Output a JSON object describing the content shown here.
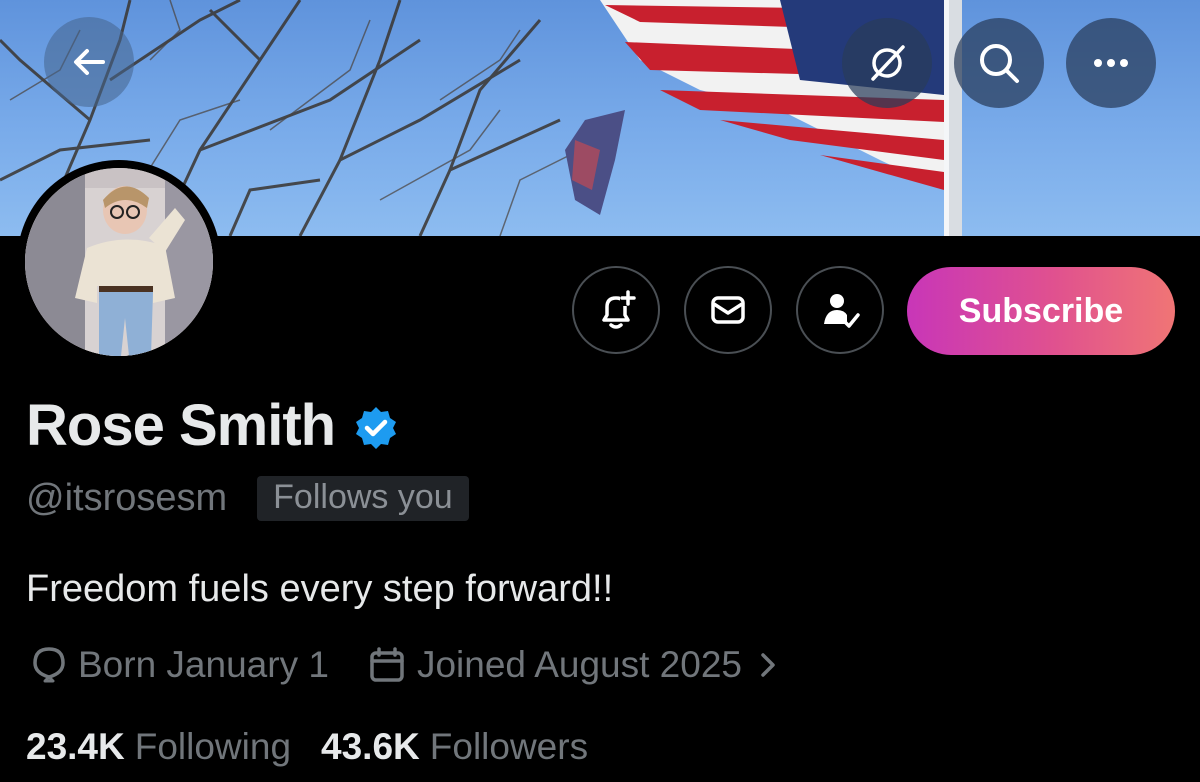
{
  "header": {
    "back_icon": "arrow-left-icon",
    "grok_icon": "grok-icon",
    "search_icon": "search-icon",
    "more_icon": "more-horizontal-icon"
  },
  "profile": {
    "name": "Rose Smith",
    "verified": true,
    "handle": "@itsrosesm",
    "follows_you": "Follows you",
    "bio": "Freedom fuels every step forward!!",
    "birthday": "Born January 1",
    "joined": "Joined August 2025"
  },
  "actions": {
    "notify_icon": "bell-plus-icon",
    "message_icon": "envelope-icon",
    "follow_icon": "person-check-icon",
    "subscribe_label": "Subscribe"
  },
  "stats": {
    "following_count": "23.4K",
    "following_label": "Following",
    "followers_count": "43.6K",
    "followers_label": "Followers"
  },
  "colors": {
    "background": "#000000",
    "text_primary": "#e7e9ea",
    "text_secondary": "#71767b",
    "verified_blue": "#1d9bf0",
    "subscribe_gradient_start": "#c836b8",
    "subscribe_gradient_end": "#f07575"
  }
}
